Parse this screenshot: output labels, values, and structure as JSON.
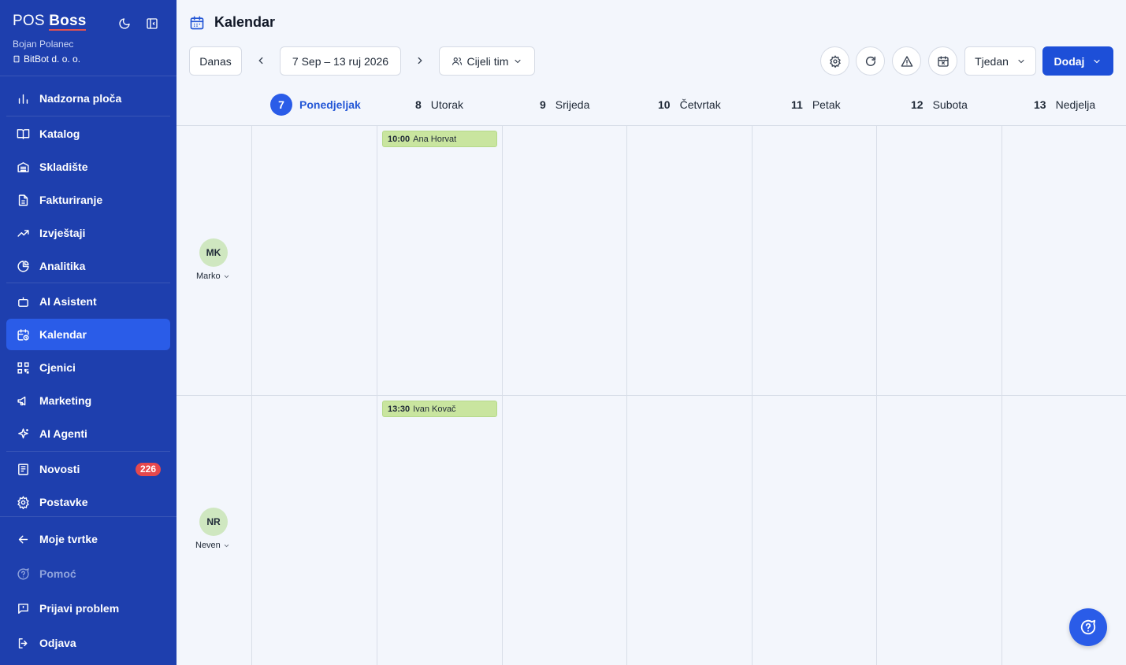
{
  "sidebar": {
    "brand_pos": "POS",
    "brand_boss": "Boss",
    "user_name": "Bojan Polanec",
    "company": "BitBot d. o. o.",
    "items": [
      {
        "label": "Nadzorna ploča",
        "icon": "bar-chart-icon"
      },
      {
        "label": "Katalog",
        "icon": "book-icon"
      },
      {
        "label": "Skladište",
        "icon": "warehouse-icon"
      },
      {
        "label": "Fakturiranje",
        "icon": "document-icon"
      },
      {
        "label": "Izvještaji",
        "icon": "trending-up-icon"
      },
      {
        "label": "Analitika",
        "icon": "pie-chart-icon"
      },
      {
        "label": "AI Asistent",
        "icon": "bot-icon"
      },
      {
        "label": "Kalendar",
        "icon": "calendar-clock-icon"
      },
      {
        "label": "Cjenici",
        "icon": "qr-code-icon"
      },
      {
        "label": "Marketing",
        "icon": "megaphone-icon"
      },
      {
        "label": "AI Agenti",
        "icon": "sparkles-icon"
      },
      {
        "label": "Novosti",
        "icon": "newspaper-icon",
        "badge": "226"
      },
      {
        "label": "Postavke",
        "icon": "gear-icon"
      },
      {
        "label": "Moje tvrtke",
        "icon": "arrow-left-icon"
      },
      {
        "label": "Pomoć",
        "icon": "help-circle-icon"
      },
      {
        "label": "Prijavi problem",
        "icon": "message-alert-icon"
      },
      {
        "label": "Odjava",
        "icon": "logout-icon"
      }
    ]
  },
  "header": {
    "title": "Kalendar",
    "today_label": "Danas",
    "date_range": "7 Sep – 13 ruj 2026",
    "team_label": "Cijeli tim",
    "view_label": "Tjedan",
    "add_label": "Dodaj"
  },
  "days": [
    {
      "num": "7",
      "name": "Ponedjeljak",
      "today": true
    },
    {
      "num": "8",
      "name": "Utorak"
    },
    {
      "num": "9",
      "name": "Srijeda"
    },
    {
      "num": "10",
      "name": "Četvrtak"
    },
    {
      "num": "11",
      "name": "Petak"
    },
    {
      "num": "12",
      "name": "Subota"
    },
    {
      "num": "13",
      "name": "Nedjelja"
    }
  ],
  "members": [
    {
      "initials": "MK",
      "name": "Marko"
    },
    {
      "initials": "NR",
      "name": "Neven"
    }
  ],
  "events": [
    {
      "time": "10:00",
      "client": "Ana Horvat"
    },
    {
      "time": "13:30",
      "client": "Ivan Kovač"
    }
  ],
  "colors": {
    "sidebar_bg": "#1e3fae",
    "active_item": "#2a5ce8",
    "primary": "#1d4fd8",
    "event_bg": "#c9e59f",
    "avatar_bg": "#cfe7c0",
    "badge": "#e5484d"
  }
}
